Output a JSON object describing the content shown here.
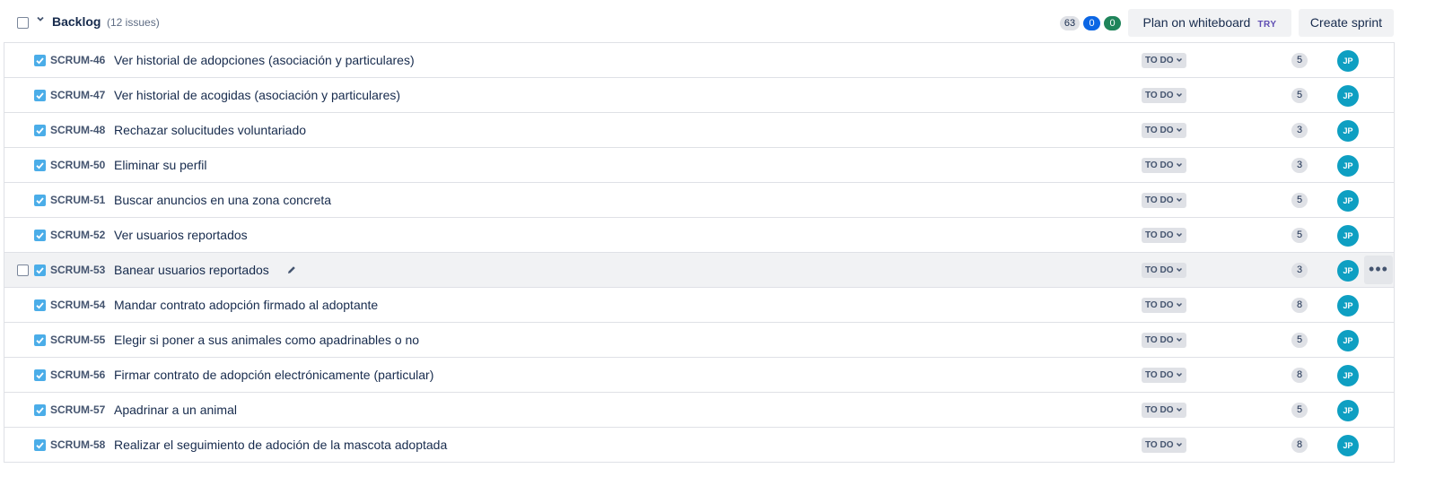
{
  "backlog": {
    "title": "Backlog",
    "issue_count": "(12 issues)",
    "counters": {
      "todo_points": "63",
      "in_progress_points": "0",
      "done_points": "0"
    },
    "plan_whiteboard_label": "Plan on whiteboard",
    "try_badge": "TRY",
    "create_sprint_label": "Create sprint"
  },
  "issues": [
    {
      "key": "SCRUM-46",
      "summary": "Ver historial de adopciones (asociación y particulares)",
      "status": "TO DO",
      "points": "5",
      "assignee": "JP"
    },
    {
      "key": "SCRUM-47",
      "summary": "Ver historial de acogidas (asociación y particulares)",
      "status": "TO DO",
      "points": "5",
      "assignee": "JP"
    },
    {
      "key": "SCRUM-48",
      "summary": "Rechazar solucitudes voluntariado",
      "status": "TO DO",
      "points": "3",
      "assignee": "JP"
    },
    {
      "key": "SCRUM-50",
      "summary": "Eliminar su perfil",
      "status": "TO DO",
      "points": "3",
      "assignee": "JP"
    },
    {
      "key": "SCRUM-51",
      "summary": "Buscar anuncios en una zona concreta",
      "status": "TO DO",
      "points": "5",
      "assignee": "JP"
    },
    {
      "key": "SCRUM-52",
      "summary": "Ver usuarios reportados",
      "status": "TO DO",
      "points": "5",
      "assignee": "JP"
    },
    {
      "key": "SCRUM-53",
      "summary": "Banear usuarios reportados",
      "status": "TO DO",
      "points": "3",
      "assignee": "JP"
    },
    {
      "key": "SCRUM-54",
      "summary": "Mandar contrato adopción firmado al adoptante",
      "status": "TO DO",
      "points": "8",
      "assignee": "JP"
    },
    {
      "key": "SCRUM-55",
      "summary": "Elegir si poner a sus animales como apadrinables o no",
      "status": "TO DO",
      "points": "5",
      "assignee": "JP"
    },
    {
      "key": "SCRUM-56",
      "summary": "Firmar contrato de adopción electrónicamente (particular)",
      "status": "TO DO",
      "points": "8",
      "assignee": "JP"
    },
    {
      "key": "SCRUM-57",
      "summary": "Apadrinar a un animal",
      "status": "TO DO",
      "points": "5",
      "assignee": "JP"
    },
    {
      "key": "SCRUM-58",
      "summary": "Realizar el seguimiento de adoción de la mascota adoptada",
      "status": "TO DO",
      "points": "8",
      "assignee": "JP"
    }
  ],
  "more_actions_glyph": "•••"
}
